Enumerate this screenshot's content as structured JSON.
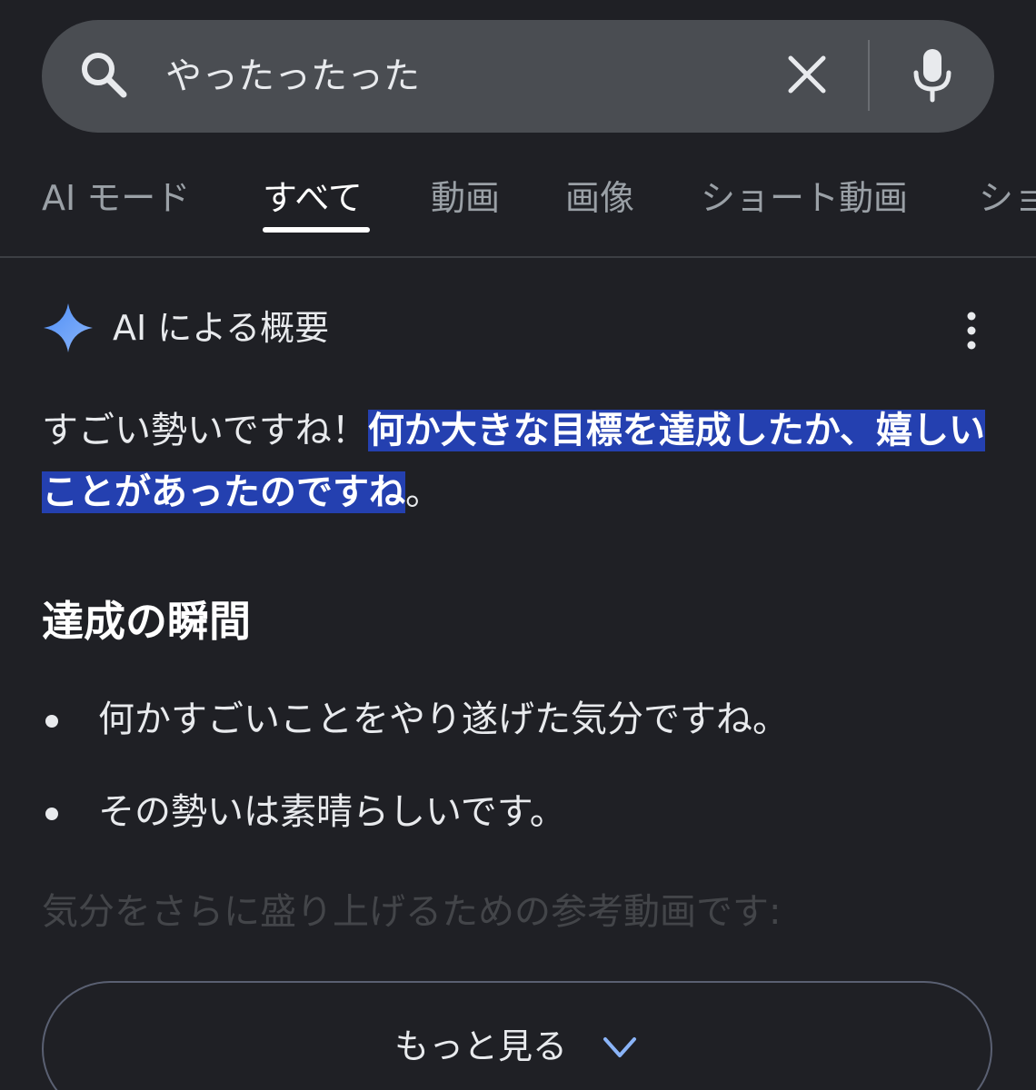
{
  "search": {
    "query": "やったったった",
    "search_icon": "search-icon",
    "clear_icon": "close-icon",
    "mic_icon": "mic-icon"
  },
  "tabs": [
    {
      "label": "AI モード",
      "active": false
    },
    {
      "label": "すべて",
      "active": true
    },
    {
      "label": "動画",
      "active": false
    },
    {
      "label": "画像",
      "active": false
    },
    {
      "label": "ショート動画",
      "active": false
    },
    {
      "label": "ショ",
      "active": false
    }
  ],
  "ai_overview": {
    "title": "AI による概要",
    "spark_icon": "sparkle-icon",
    "menu_icon": "more-vert-icon",
    "intro_plain": "すごい勢いですね！",
    "intro_highlight": "何か大きな目標を達成したか、嬉しいことがあったのですね",
    "intro_end": "。",
    "heading": "達成の瞬間",
    "bullets": [
      "何かすごいことをやり遂げた気分ですね。",
      "その勢いは素晴らしいです。"
    ],
    "faded_text": "気分をさらに盛り上げるための参考動画です:",
    "show_more_label": "もっと見る",
    "show_more_icon": "chevron-down-icon"
  },
  "colors": {
    "background": "#1f2025",
    "searchbar": "#4a4d52",
    "highlight": "#2440b0",
    "sparkle": "#5aa0ff",
    "chevron": "#8ab4f8"
  }
}
